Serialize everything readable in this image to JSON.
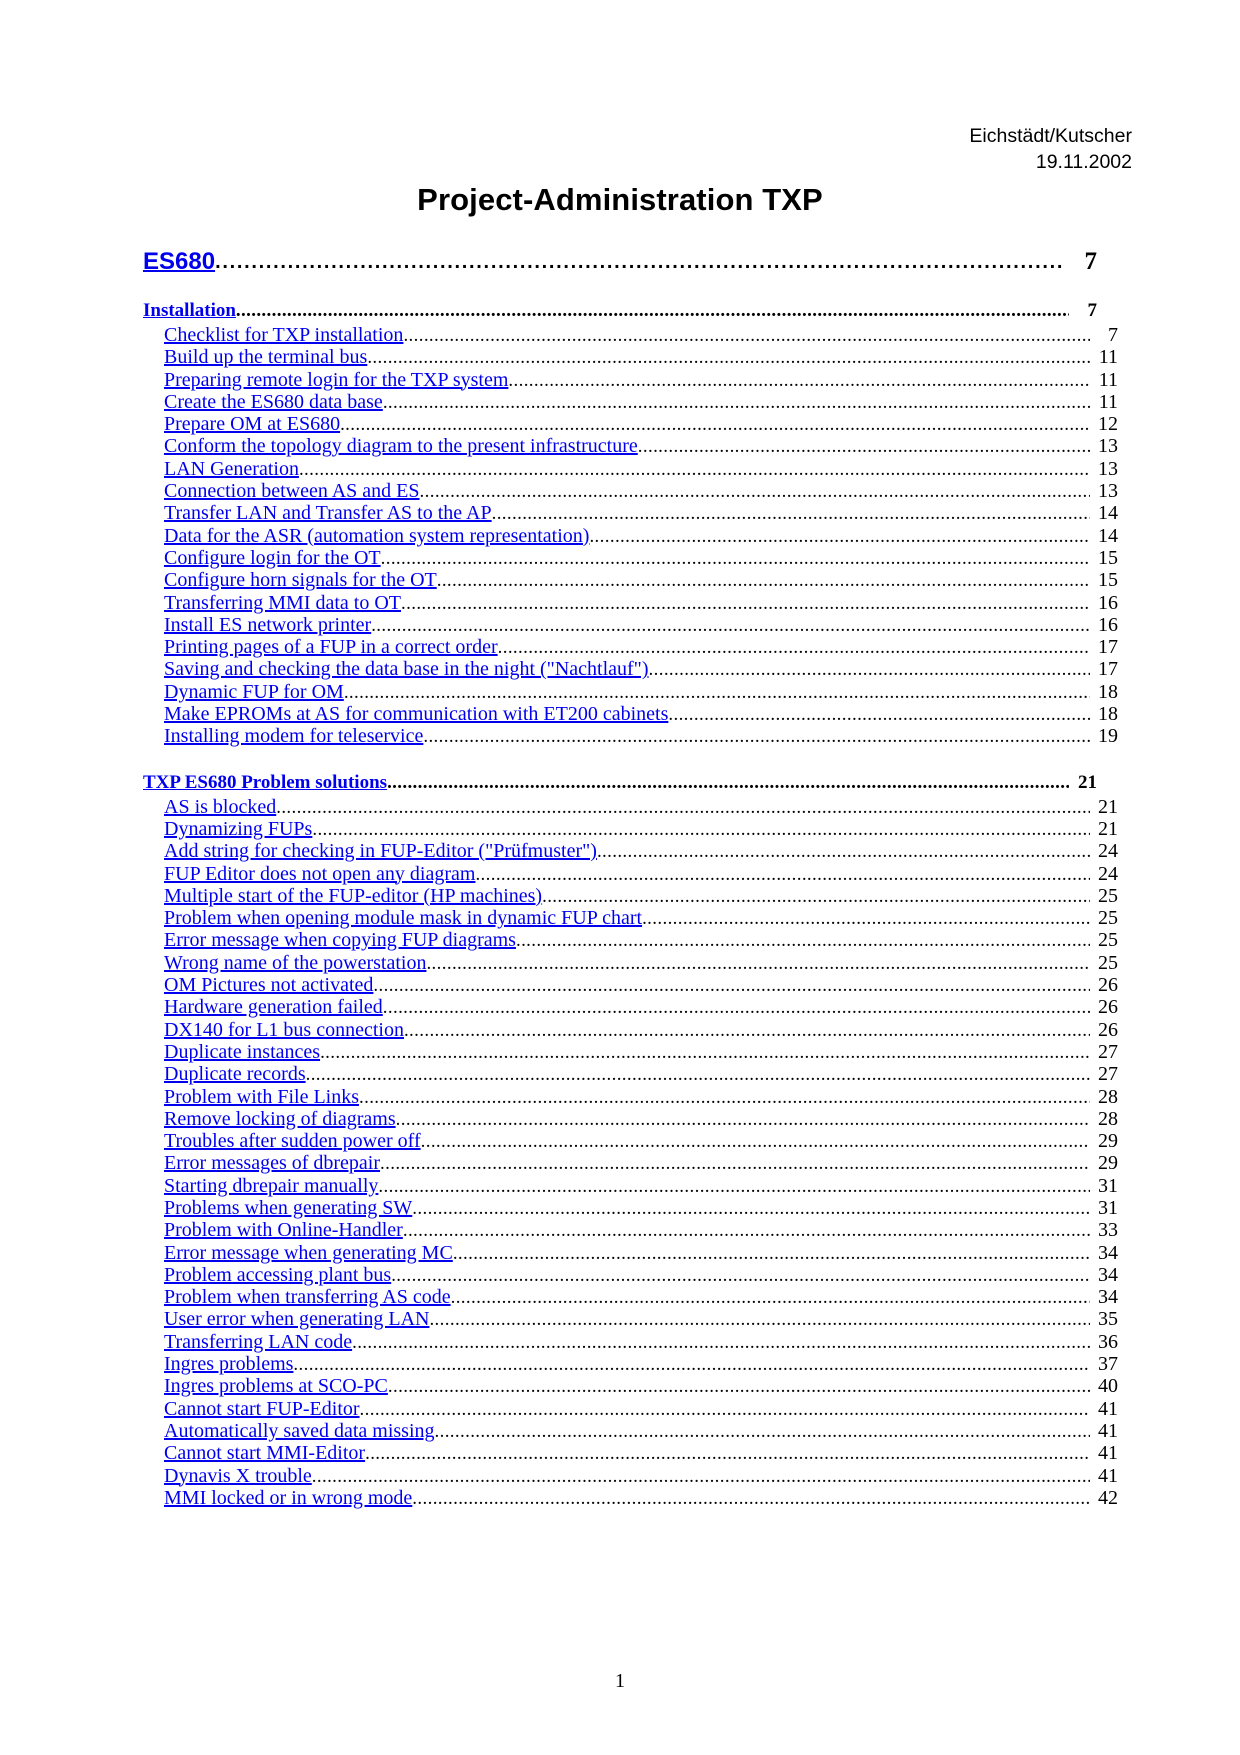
{
  "header": {
    "authors": "Eichstädt/Kutscher",
    "date": "19.11.2002"
  },
  "title": "Project-Administration TXP",
  "footer": {
    "page_number": "1"
  },
  "colors": {
    "link": "#0000ee",
    "text": "#000000",
    "background": "#ffffff"
  },
  "toc": {
    "level1": {
      "label": "ES680",
      "page": "7"
    },
    "sections": [
      {
        "heading": {
          "label": "Installation",
          "page": "7"
        },
        "entries": [
          {
            "label": "Checklist for TXP installation",
            "page": "7"
          },
          {
            "label": "Build up the terminal bus",
            "page": "11"
          },
          {
            "label": "Preparing remote login for the TXP system",
            "page": "11"
          },
          {
            "label": "Create the ES680 data base",
            "page": "11"
          },
          {
            "label": "Prepare OM at ES680",
            "page": "12"
          },
          {
            "label": "Conform the topology diagram to the present infrastructure",
            "page": "13"
          },
          {
            "label": "LAN Generation",
            "page": "13"
          },
          {
            "label": "Connection between AS and ES",
            "page": "13"
          },
          {
            "label": "Transfer LAN and Transfer AS to the AP",
            "page": "14"
          },
          {
            "label": "Data for the ASR (automation system representation)",
            "page": "14"
          },
          {
            "label": "Configure login for the OT",
            "page": "15"
          },
          {
            "label": "Configure horn signals for the OT",
            "page": "15"
          },
          {
            "label": "Transferring MMI data to OT",
            "page": "16"
          },
          {
            "label": "Install ES network printer",
            "page": "16"
          },
          {
            "label": "Printing pages of a FUP in a correct order",
            "page": "17"
          },
          {
            "label": "Saving and checking the data base in the night (\"Nachtlauf\")",
            "page": "17"
          },
          {
            "label": "Dynamic FUP for OM",
            "page": "18"
          },
          {
            "label": "Make EPROMs at AS for communication with ET200 cabinets",
            "page": "18"
          },
          {
            "label": "Installing modem for teleservice",
            "page": "19"
          }
        ]
      },
      {
        "heading": {
          "label": "TXP ES680 Problem solutions",
          "page": "21"
        },
        "entries": [
          {
            "label": "AS is blocked",
            "page": "21"
          },
          {
            "label": "Dynamizing FUPs",
            "page": "21"
          },
          {
            "label": "Add string for checking in FUP-Editor (\"Prüfmuster\")",
            "page": "24"
          },
          {
            "label": "FUP Editor does not open any diagram",
            "page": "24"
          },
          {
            "label": "Multiple start of the FUP-editor (HP machines)",
            "page": "25"
          },
          {
            "label": "Problem when opening module mask in dynamic FUP chart",
            "page": "25"
          },
          {
            "label": "Error message when copying FUP diagrams",
            "page": "25"
          },
          {
            "label": "Wrong name of the powerstation",
            "page": "25"
          },
          {
            "label": "OM Pictures not activated",
            "page": "26"
          },
          {
            "label": "Hardware generation failed",
            "page": "26"
          },
          {
            "label": "DX140 for L1 bus connection",
            "page": "26"
          },
          {
            "label": "Duplicate instances",
            "page": "27"
          },
          {
            "label": "Duplicate records",
            "page": "27"
          },
          {
            "label": "Problem with File Links",
            "page": "28"
          },
          {
            "label": "Remove locking of diagrams",
            "page": "28"
          },
          {
            "label": "Troubles after sudden power off",
            "page": "29"
          },
          {
            "label": "Error messages of dbrepair",
            "page": "29"
          },
          {
            "label": "Starting dbrepair manually",
            "page": "31"
          },
          {
            "label": "Problems when generating SW",
            "page": "31"
          },
          {
            "label": "Problem with Online-Handler",
            "page": "33"
          },
          {
            "label": "Error message when generating MC",
            "page": "34"
          },
          {
            "label": "Problem accessing plant bus",
            "page": "34"
          },
          {
            "label": "Problem when transferring AS code",
            "page": "34"
          },
          {
            "label": "User error when generating LAN",
            "page": "35"
          },
          {
            "label": "Transferring LAN code",
            "page": "36"
          },
          {
            "label": "Ingres problems",
            "page": "37"
          },
          {
            "label": "Ingres problems at SCO-PC",
            "page": "40"
          },
          {
            "label": "Cannot start FUP-Editor",
            "page": "41"
          },
          {
            "label": "Automatically saved data missing",
            "page": "41"
          },
          {
            "label": "Cannot start MMI-Editor",
            "page": "41"
          },
          {
            "label": "Dynavis X trouble",
            "page": "41"
          },
          {
            "label": "MMI locked or in wrong mode",
            "page": "42"
          }
        ]
      }
    ]
  }
}
